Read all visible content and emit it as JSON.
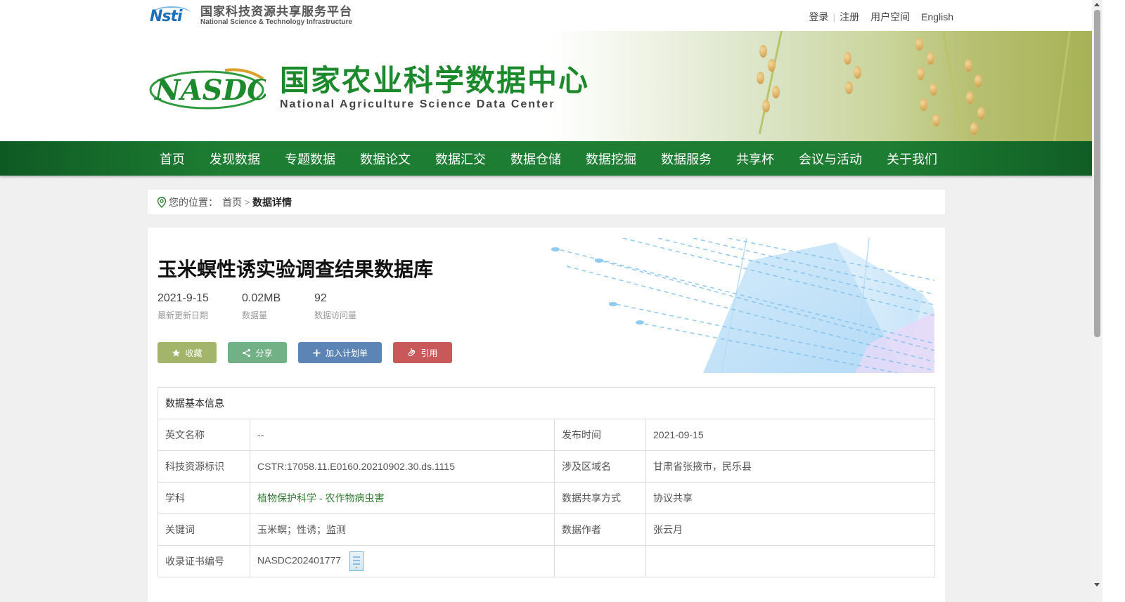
{
  "header": {
    "nsti_logo_cn": "国家科技资源共享服务平台",
    "nsti_logo_en": "National Science & Technology Infrastructure",
    "nsti_mark": "Nsti",
    "links": {
      "login": "登录",
      "register": "注册",
      "user_space": "用户空间",
      "english": "English"
    }
  },
  "banner": {
    "title_cn": "国家农业科学数据中心",
    "title_en": "National Agriculture Science Data Center",
    "logo_text": "NASDC"
  },
  "nav": {
    "items": [
      "首页",
      "发现数据",
      "专题数据",
      "数据论文",
      "数据汇交",
      "数据仓储",
      "数据挖掘",
      "数据服务",
      "共享杯",
      "会议与活动",
      "关于我们"
    ]
  },
  "breadcrumb": {
    "prefix": "您的位置：",
    "home": "首页",
    "current": "数据详情"
  },
  "dataset": {
    "title": "玉米螟性诱实验调查结果数据库",
    "stats": [
      {
        "value": "2021-9-15",
        "label": "最新更新日期"
      },
      {
        "value": "0.02MB",
        "label": "数据量"
      },
      {
        "value": "92",
        "label": "数据访问量"
      }
    ],
    "buttons": {
      "favorite": "收藏",
      "share": "分享",
      "add_plan": "加入计划单",
      "cite": "引用"
    }
  },
  "info_table": {
    "header": "数据基本信息",
    "rows": [
      {
        "k1": "英文名称",
        "v1": "--",
        "k2": "发布时间",
        "v2": "2021-09-15"
      },
      {
        "k1": "科技资源标识",
        "v1": "CSTR:17058.11.E0160.20210902.30.ds.1115",
        "k2": "涉及区域名",
        "v2": "甘肃省张掖市，民乐县"
      },
      {
        "k1": "学科",
        "v1": "植物保护科学 - 农作物病虫害",
        "k2": "数据共享方式",
        "v2": "协议共享"
      },
      {
        "k1": "关键词",
        "v1": "玉米螟；性诱；监测",
        "k2": "数据作者",
        "v2": "张云月"
      },
      {
        "k1": "收录证书编号",
        "v1": "NASDC202401777",
        "k2": "",
        "v2": ""
      }
    ]
  },
  "colors": {
    "nav_green": "#1d7d32",
    "brand_green": "#1c8a2c",
    "btn_favorite": "#a2b56a",
    "btn_share": "#72b085",
    "btn_plan": "#5c84b5",
    "btn_cite": "#c9585a"
  }
}
